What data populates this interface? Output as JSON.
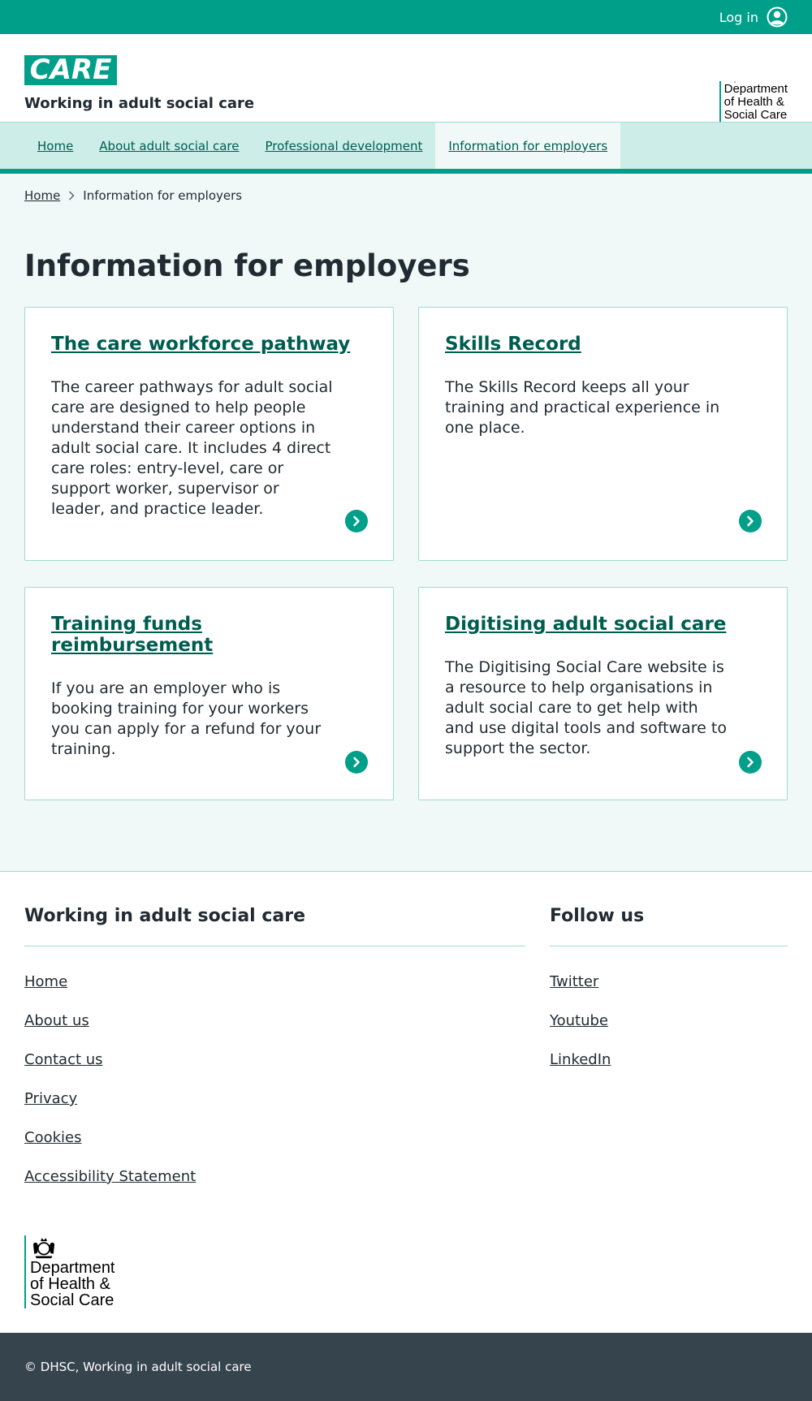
{
  "topbar": {
    "login_label": "Log in",
    "login_icon": "user-circle-icon"
  },
  "header": {
    "logo_text": "CARE",
    "service_name": "Working in adult social care",
    "dhsc_lines": [
      "Department",
      "of Health &",
      "Social Care"
    ]
  },
  "nav": {
    "items": [
      {
        "label": "Home",
        "active": false
      },
      {
        "label": "About adult social care",
        "active": false
      },
      {
        "label": "Professional development",
        "active": false
      },
      {
        "label": "Information for employers",
        "active": true
      }
    ]
  },
  "breadcrumb": {
    "home": "Home",
    "current": "Information for employers"
  },
  "page_title": "Information for employers",
  "cards": [
    {
      "title": "The care workforce pathway",
      "text": "The career pathways for adult social care are designed to help people understand their career options in adult social care. It includes 4 direct care roles: entry-level, care or support worker, supervisor or leader, and practice leader."
    },
    {
      "title": "Skills Record",
      "text": "The Skills Record keeps all your training and practical experience in one place."
    },
    {
      "title": "Training funds reimbursement",
      "text": "If you are an employer who is booking training for your workers you can apply for a refund for your training."
    },
    {
      "title": "Digitising adult social care",
      "text": "The Digitising Social Care website is a resource to help organisations in adult social care to get help with and use digital tools and software to support the sector."
    }
  ],
  "footer": {
    "col1_heading": "Working in adult social care",
    "col1_links": [
      "Home",
      "About us",
      "Contact us",
      "Privacy",
      "Cookies",
      "Accessibility Statement"
    ],
    "col2_heading": "Follow us",
    "col2_links": [
      "Twitter",
      "Youtube",
      "LinkedIn"
    ],
    "dhsc_lines": [
      "Department",
      "of Health &",
      "Social Care"
    ],
    "copyright": "© DHSC, Working in adult social care"
  },
  "colors": {
    "brand": "#009f89",
    "link": "#005c4f",
    "nav_bg": "#cdeee8",
    "page_bg": "#f0f9f8",
    "bottom_bar": "#36444e"
  }
}
